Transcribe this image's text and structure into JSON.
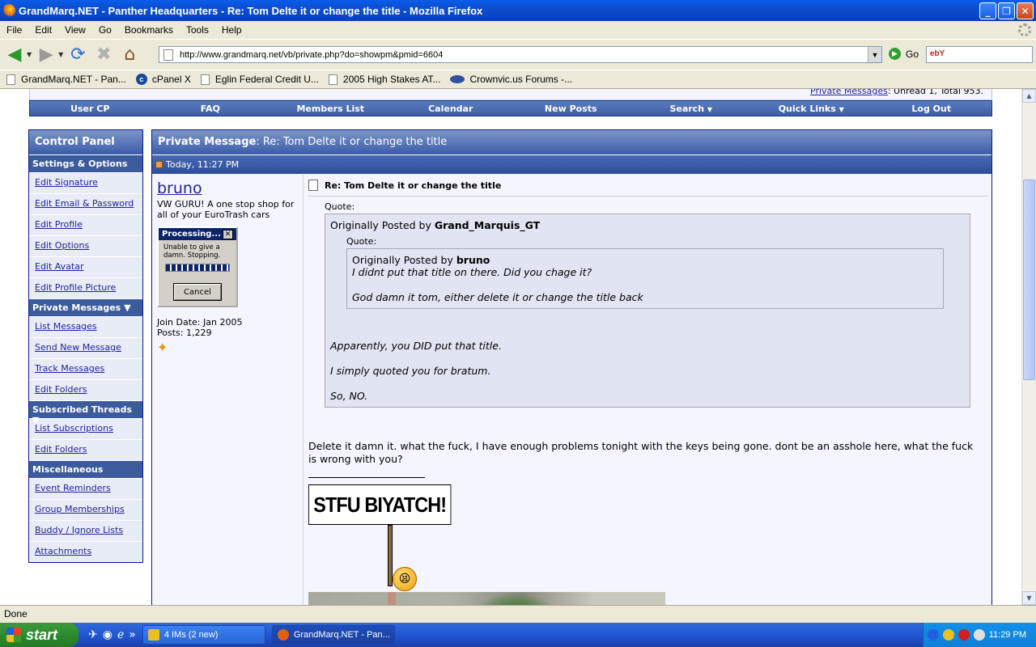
{
  "window": {
    "title": "GrandMarq.NET - Panther Headquarters - Re: Tom Delte it or change the title - Mozilla Firefox",
    "minimize": "_",
    "maximize": "❐",
    "close": "✕"
  },
  "menu": [
    "File",
    "Edit",
    "View",
    "Go",
    "Bookmarks",
    "Tools",
    "Help"
  ],
  "nav": {
    "url": "http://www.grandmarq.net/vb/private.php?do=showpm&pmid=6604",
    "go_label": "Go",
    "search_engine": "ebY"
  },
  "bookmarks": [
    "GrandMarq.NET - Pan...",
    "cPanel X",
    "Eglin Federal Credit U...",
    "2005 High Stakes AT...",
    "Crownvic.us Forums -..."
  ],
  "top_remnant": {
    "link": "Private Messages",
    "text": ": Unread 1, Total 953."
  },
  "forum_nav": [
    "User CP",
    "FAQ",
    "Members List",
    "Calendar",
    "New Posts",
    "Search",
    "Quick Links",
    "Log Out"
  ],
  "control_panel": {
    "title": "Control Panel",
    "sections": [
      {
        "label": "Settings & Options",
        "items": [
          "Edit Signature",
          "Edit Email & Password",
          "Edit Profile",
          "Edit Options",
          "Edit Avatar",
          "Edit Profile Picture"
        ]
      },
      {
        "label": "Private Messages",
        "items": [
          "List Messages",
          "Send New Message",
          "Track Messages",
          "Edit Folders"
        ]
      },
      {
        "label": "Subscribed Threads",
        "items": [
          "List Subscriptions",
          "Edit Folders"
        ]
      },
      {
        "label": "Miscellaneous",
        "items": [
          "Event Reminders",
          "Group Memberships",
          "Buddy / Ignore Lists",
          "Attachments"
        ]
      }
    ]
  },
  "message": {
    "header_label": "Private Message",
    "header_title": ": Re: Tom Delte it or change the title",
    "date": "Today, 11:27 PM",
    "user": {
      "name": "bruno",
      "title": "VW GURU! A one stop shop for all of your EuroTrash cars",
      "avatar_title": "Processing...",
      "avatar_text": "Unable to give a damn. Stopping.",
      "avatar_cancel": "Cancel",
      "join_date": "Join Date: Jan 2005",
      "posts": "Posts: 1,229"
    },
    "post_title": "Re: Tom Delte it or change the title",
    "quote_label": "Quote:",
    "outer_quote": {
      "by_prefix": "Originally Posted by",
      "author": "Grand_Marquis_GT",
      "lines": [
        "Apparently, you DID put that title.",
        "I simply quoted you for bratum.",
        "So, NO."
      ]
    },
    "inner_quote": {
      "by_prefix": "Originally Posted by",
      "author": "bruno",
      "lines": [
        "I didnt put that title on there. Did you chage it?",
        "God damn it tom, either delete it or change the title back"
      ]
    },
    "reply": "Delete it damn it. what the fuck, I have enough problems tonight with the keys being gone. dont be an asshole here, what the fuck is wrong with you?",
    "sign_text": "STFU BIYATCH!"
  },
  "status": "Done",
  "taskbar": {
    "start": "start",
    "items": [
      "4 IMs (2 new)",
      "GrandMarq.NET - Pan..."
    ],
    "clock": "11:29 PM"
  }
}
